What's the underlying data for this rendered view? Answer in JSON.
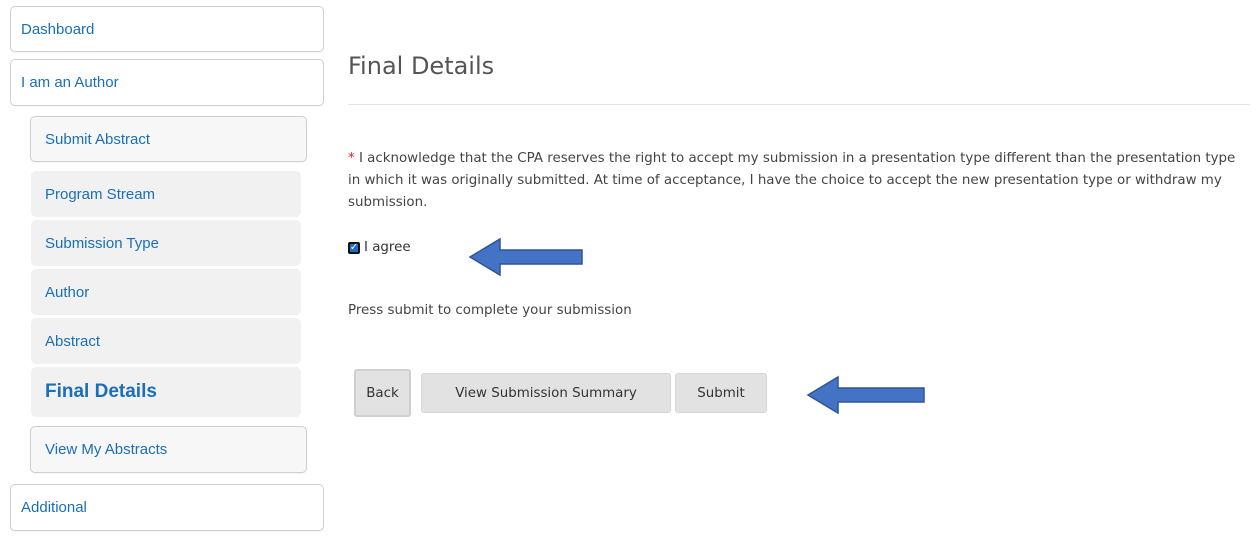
{
  "sidebar": {
    "dashboard": "Dashboard",
    "author": "I am an Author",
    "submit_abstract": "Submit Abstract",
    "steps": [
      "Program Stream",
      "Submission Type",
      "Author",
      "Abstract",
      "Final Details"
    ],
    "view_abstracts": "View My Abstracts",
    "additional": "Additional"
  },
  "main": {
    "title": "Final Details",
    "required_mark": "*",
    "acknowledgement": "I acknowledge that the CPA reserves the right to accept my submission in a presentation type different than the presentation type in which it was originally submitted. At time of acceptance, I have the choice to accept the new presentation type or withdraw my submission.",
    "agree_label": "I agree",
    "agree_checked": true,
    "press_text": "Press submit to complete your submission",
    "buttons": {
      "back": "Back",
      "summary": "View Submission Summary",
      "submit": "Submit"
    }
  },
  "colors": {
    "link": "#1a6fb8",
    "arrow": "#4472c4",
    "required": "#d0202a"
  },
  "icons": {
    "checkbox": "check-icon",
    "annotation": "arrow-left-icon"
  }
}
